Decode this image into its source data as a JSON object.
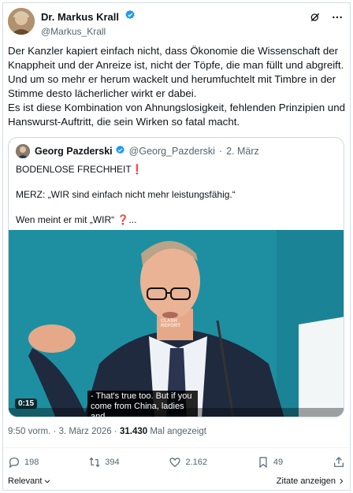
{
  "author": {
    "display_name": "Dr. Markus Krall",
    "handle": "@Markus_Krall"
  },
  "header_icons": [
    "grok-icon",
    "more-icon"
  ],
  "tweet": {
    "lines": [
      "Der Kanzler kapiert einfach nicht, dass Ökonomie die Wissenschaft der Knappheit und der Anreize ist, nicht der Töpfe, die man füllt und abgreift.",
      "Und um so mehr er herum wackelt und herumfuchtelt mit Timbre in der Stimme desto lächerlicher wirkt er dabei.",
      "Es ist diese Kombination von Ahnungslosigkeit, fehlenden Prinzipien und Hanswurst-Auftritt, die sein Wirken so fatal macht."
    ]
  },
  "quote": {
    "name": "Georg Pazderski",
    "handle": "@Georg_Pazderski",
    "date": "2. März",
    "separator": "·",
    "line1": "BODENLOSE FRECHHEIT",
    "line1_emoji": "❗",
    "line2": "MERZ: „WIR sind einfach nicht mehr leistungsfähig.“",
    "line3": "Wen meint er mit „WIR“",
    "line3_emoji": "❓",
    "line3_tail": "...",
    "video": {
      "duration": "0:15",
      "caption_line1": "- That's true too.  But if you",
      "caption_line2": "come from China, ladies and",
      "watermark_line1": "CLASH",
      "watermark_line2": "REPORT"
    }
  },
  "meta": {
    "time": "9:50 vorm.",
    "separator": "·",
    "date": "3. März 2026",
    "views": "31.430",
    "views_label": "Mal angezeigt"
  },
  "actions": {
    "replies": "198",
    "reposts": "394",
    "likes": "2.162",
    "bookmarks": "49"
  },
  "footer": {
    "sort_label": "Relevant",
    "quotes_label": "Zitate anzeigen"
  },
  "colors": {
    "verified_blue": "#1d9bf0",
    "text_primary": "#0f1419",
    "text_secondary": "#536471",
    "video_bg": "#1e8fa1"
  }
}
